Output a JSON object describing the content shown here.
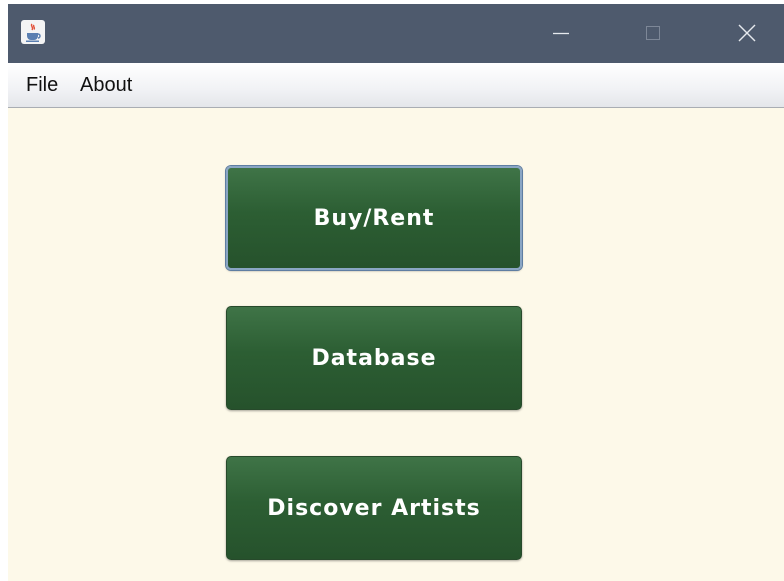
{
  "window": {
    "icon": "java-cup-icon",
    "controls": {
      "minimize": "minimize-icon",
      "maximize": "maximize-icon",
      "close": "close-icon"
    }
  },
  "menu": {
    "file": "File",
    "about": "About"
  },
  "buttons": {
    "buy_rent": "Buy/Rent",
    "database": "Database",
    "discover_artists": "Discover Artists"
  },
  "colors": {
    "background": "#fdf9e9",
    "titlebar": "#4e5a6d",
    "button": "#2c5e33",
    "focus_ring": "#8aa6c4"
  }
}
